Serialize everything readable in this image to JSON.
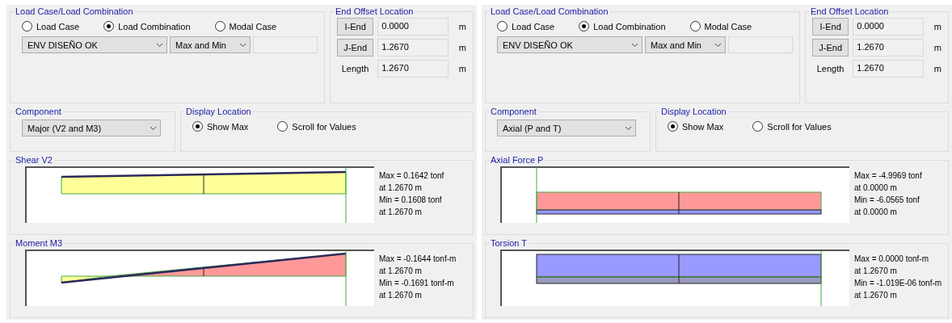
{
  "panels": [
    {
      "load_case": {
        "title": "Load Case/Load Combination",
        "options": [
          {
            "label": "Load Case",
            "selected": false
          },
          {
            "label": "Load Combination",
            "selected": true
          },
          {
            "label": "Modal Case",
            "selected": false
          }
        ],
        "combination": "ENV DISEÑO OK",
        "mode": "Max and Min"
      },
      "end_offset": {
        "title": "End Offset Location",
        "rows": [
          {
            "kind": "button",
            "label": "I-End",
            "value": "0.0000",
            "unit": "m"
          },
          {
            "kind": "button",
            "label": "J-End",
            "value": "1.2670",
            "unit": "m"
          },
          {
            "kind": "label",
            "label": "Length",
            "value": "1.2670",
            "unit": "m"
          }
        ]
      },
      "component": {
        "title": "Component",
        "value": "Major (V2 and M3)"
      },
      "display_location": {
        "title": "Display Location",
        "options": [
          {
            "label": "Show Max",
            "selected": true
          },
          {
            "label": "Scroll for Values",
            "selected": false
          }
        ]
      },
      "diagrams": [
        {
          "kind": "shear",
          "title": "Shear V2",
          "readings": [
            "Max = 0.1642 tonf",
            "at 1.2670 m",
            "Min = 0.1608 tonf",
            "at 1.2670 m"
          ]
        },
        {
          "kind": "moment",
          "title": "Moment M3",
          "readings": [
            "Max = -0.1644 tonf-m",
            "at 1.2670 m",
            "Min = -0.1691 tonf-m",
            "at 1.2670 m"
          ]
        }
      ]
    },
    {
      "load_case": {
        "title": "Load Case/Load Combination",
        "options": [
          {
            "label": "Load Case",
            "selected": false
          },
          {
            "label": "Load Combination",
            "selected": true
          },
          {
            "label": "Modal Case",
            "selected": false
          }
        ],
        "combination": "ENV DISEÑO OK",
        "mode": "Max and Min"
      },
      "end_offset": {
        "title": "End Offset Location",
        "rows": [
          {
            "kind": "button",
            "label": "I-End",
            "value": "0.0000",
            "unit": "m"
          },
          {
            "kind": "button",
            "label": "J-End",
            "value": "1.2670",
            "unit": "m"
          },
          {
            "kind": "label",
            "label": "Length",
            "value": "1.2670",
            "unit": "m"
          }
        ]
      },
      "component": {
        "title": "Component",
        "value": "Axial (P and T)"
      },
      "display_location": {
        "title": "Display Location",
        "options": [
          {
            "label": "Show Max",
            "selected": true
          },
          {
            "label": "Scroll for Values",
            "selected": false
          }
        ]
      },
      "diagrams": [
        {
          "kind": "axial",
          "title": "Axial Force P",
          "readings": [
            "Max = -4.9969 tonf",
            "at 0.0000 m",
            "Min = -6.0565 tonf",
            "at 0.0000 m"
          ]
        },
        {
          "kind": "torsion",
          "title": "Torsion T",
          "readings": [
            "Max = 0.0000 tonf-m",
            "at 1.2670 m",
            "Min = -1.019E-06 tonf-m",
            "at 1.2670 m"
          ]
        }
      ]
    }
  ]
}
